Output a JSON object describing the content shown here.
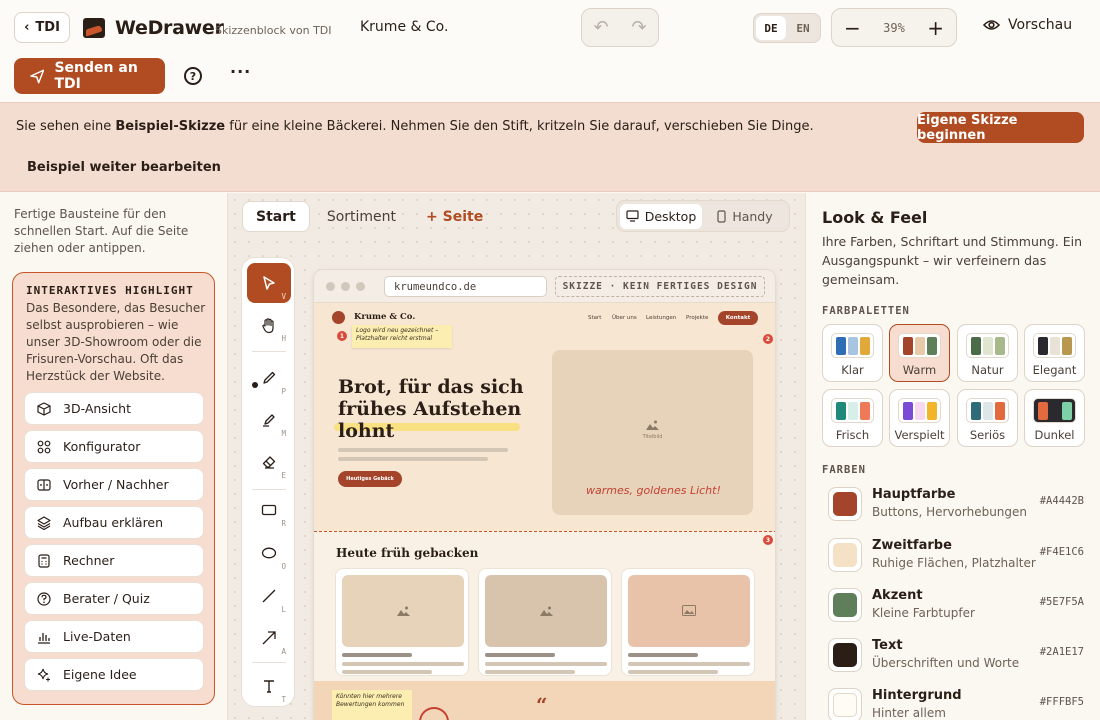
{
  "header": {
    "back_label": "TDI",
    "app_title": "WeDrawer",
    "app_subtitle": "Skizzenblock von TDI",
    "client_name": "Krume & Co.",
    "lang_options": [
      "DE",
      "EN"
    ],
    "lang_selected": "DE",
    "zoom": "39%",
    "preview_label": "Vorschau",
    "send_label": "Senden an TDI",
    "help_label": "?",
    "more_label": "···"
  },
  "banner": {
    "text_prefix": "Sie sehen eine ",
    "text_bold": "Beispiel-Skizze",
    "text_suffix": " für eine kleine Bäckerei. Nehmen Sie den Stift, kritzeln Sie darauf, verschieben Sie Dinge.",
    "cta_label": "Eigene Skizze beginnen",
    "continue_label": "Beispiel weiter bearbeiten"
  },
  "left_panel": {
    "intro": "Fertige Bausteine für den schnellen Start. Auf die Seite ziehen oder antippen.",
    "highlight_title": "INTERAKTIVES HIGHLIGHT",
    "highlight_text": "Das Besondere, das Besucher selbst ausprobieren – wie unser 3D-Showroom oder die Frisuren-Vorschau. Oft das Herzstück der Website.",
    "items": [
      {
        "label": "3D-Ansicht",
        "icon": "cube-icon"
      },
      {
        "label": "Konfigurator",
        "icon": "grid-icon"
      },
      {
        "label": "Vorher / Nachher",
        "icon": "compare-icon"
      },
      {
        "label": "Aufbau erklären",
        "icon": "layers-icon"
      },
      {
        "label": "Rechner",
        "icon": "calculator-icon"
      },
      {
        "label": "Berater / Quiz",
        "icon": "question-icon"
      },
      {
        "label": "Live-Daten",
        "icon": "bar-chart-icon"
      },
      {
        "label": "Eigene Idee",
        "icon": "sparkle-icon"
      }
    ]
  },
  "canvas": {
    "page_tabs": [
      "Start",
      "Sortiment"
    ],
    "add_page_label": "+ Seite",
    "devices": [
      "Desktop",
      "Handy"
    ],
    "device_selected": "Desktop",
    "tools": [
      {
        "key": "V",
        "icon": "cursor-icon"
      },
      {
        "key": "H",
        "icon": "hand-icon"
      },
      {
        "key": "P",
        "icon": "pen-icon"
      },
      {
        "key": "M",
        "icon": "marker-icon"
      },
      {
        "key": "E",
        "icon": "eraser-icon"
      },
      {
        "key": "R",
        "icon": "rectangle-icon"
      },
      {
        "key": "O",
        "icon": "ellipse-icon"
      },
      {
        "key": "L",
        "icon": "line-icon"
      },
      {
        "key": "A",
        "icon": "arrow-icon"
      },
      {
        "key": "T",
        "icon": "text-icon"
      }
    ],
    "mock": {
      "url": "krumeundco.de",
      "sketch_tag": "SKIZZE · KEIN FERTIGES DESIGN",
      "brand": "Krume & Co.",
      "nav": [
        "Start",
        "Über uns",
        "Leistungen",
        "Projekte"
      ],
      "nav_cta": "Kontakt",
      "sticky_note_1": "Logo wird neu gezeichnet – Platzhalter reicht erstmal",
      "hero_headline": "Brot, für das sich frühes Aufstehen lohnt",
      "hero_button": "Heutiges Gebäck",
      "hero_image_label": "Titelbild",
      "hand_note": "warmes, goldenes Licht!",
      "section_heading": "Heute früh gebacken",
      "sticky_note_2": "Könnten hier mehrere Bewertungen kommen",
      "quote_mark": "“",
      "badge_1": "1",
      "badge_2": "2",
      "badge_3": "3"
    }
  },
  "right_panel": {
    "title": "Look & Feel",
    "description": "Ihre Farben, Schriftart und Stimmung. Ein Ausgangspunkt – wir verfeinern das gemeinsam.",
    "palettes_heading": "FARBPALETTEN",
    "palettes": [
      {
        "name": "Klar",
        "colors": [
          "#2f6db5",
          "#a9c4e0",
          "#e0a93a"
        ]
      },
      {
        "name": "Warm",
        "colors": [
          "#a4442b",
          "#e8c9a8",
          "#5e7f5a"
        ]
      },
      {
        "name": "Natur",
        "colors": [
          "#4c6b48",
          "#dfe6d0",
          "#a7b98a"
        ]
      },
      {
        "name": "Elegant",
        "colors": [
          "#2a2a2e",
          "#e9e2d6",
          "#b8974e"
        ]
      },
      {
        "name": "Frisch",
        "colors": [
          "#1f8a7a",
          "#d8efe9",
          "#ef7a5a"
        ]
      },
      {
        "name": "Verspielt",
        "colors": [
          "#7b4bd6",
          "#f6d9ef",
          "#f2b52a"
        ]
      },
      {
        "name": "Seriös",
        "colors": [
          "#2f6a78",
          "#dfe6ea",
          "#e26a3c"
        ]
      },
      {
        "name": "Dunkel",
        "colors": [
          "#e26a3c",
          "#2a2a2e",
          "#7ed1a6"
        ]
      }
    ],
    "palette_selected": "Warm",
    "colors_heading": "FARBEN",
    "colors": [
      {
        "name": "Hauptfarbe",
        "hint": "Buttons, Hervorhebungen",
        "hex": "#A4442B"
      },
      {
        "name": "Zweitfarbe",
        "hint": "Ruhige Flächen, Platzhalter",
        "hex": "#F4E1C6"
      },
      {
        "name": "Akzent",
        "hint": "Kleine Farbtupfer",
        "hex": "#5E7F5A"
      },
      {
        "name": "Text",
        "hint": "Überschriften und Worte",
        "hex": "#2A1E17"
      },
      {
        "name": "Hintergrund",
        "hint": "Hinter allem",
        "hex": "#FFFBF5"
      }
    ]
  },
  "theme": {
    "accent": "#b04b22",
    "banner_bg": "#f3ddd0"
  }
}
